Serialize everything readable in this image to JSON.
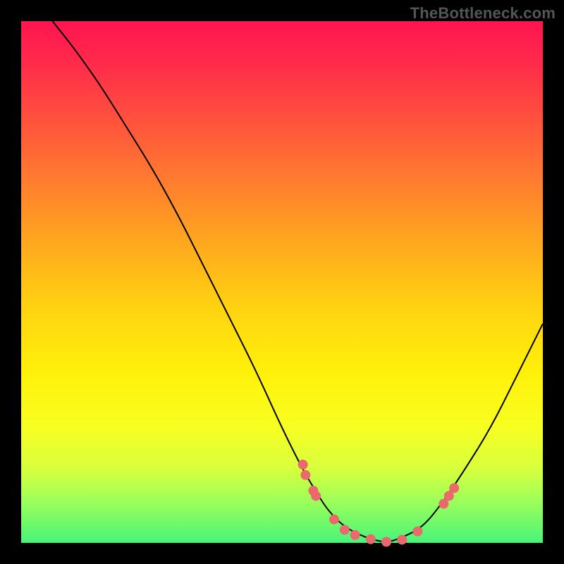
{
  "watermark": "TheBottleneck.com",
  "colors": {
    "curve": "#000000",
    "marker": "#e9696d"
  },
  "chart_data": {
    "type": "line",
    "title": "",
    "xlabel": "",
    "ylabel": "",
    "xlim": [
      0,
      100
    ],
    "ylim": [
      0,
      100
    ],
    "grid": false,
    "legend": false,
    "series": [
      {
        "name": "curve",
        "x": [
          6,
          10,
          15,
          20,
          25,
          30,
          35,
          40,
          45,
          50,
          54,
          57,
          59,
          62,
          66,
          70,
          73,
          77,
          81,
          85,
          90,
          95,
          100
        ],
        "y": [
          100,
          95,
          88,
          80,
          72,
          63,
          53,
          43,
          33,
          22,
          14,
          9,
          6,
          3,
          1,
          0,
          1,
          3,
          8,
          14,
          22,
          32,
          42
        ]
      }
    ],
    "markers": {
      "name": "dots",
      "x": [
        54,
        54.5,
        56,
        56.5,
        60,
        62,
        64,
        67,
        70,
        73,
        76,
        81,
        82,
        83
      ],
      "y": [
        15,
        13,
        10,
        9,
        4.5,
        2.5,
        1.5,
        0.7,
        0.2,
        0.6,
        2.2,
        7.5,
        9,
        10.5
      ]
    }
  }
}
